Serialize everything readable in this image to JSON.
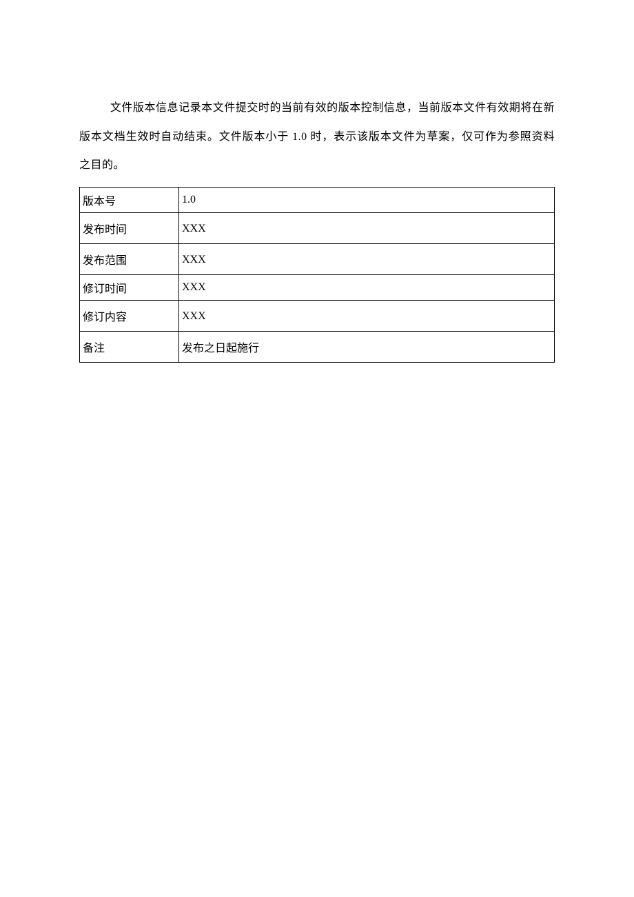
{
  "intro_text": "文件版本信息记录本文件提交时的当前有效的版本控制信息，当前版本文件有效期将在新版本文档生效时自动结束。文件版本小于 1.0 时，表示该版本文件为草案，仅可作为参照资料之目的。",
  "table": {
    "rows": [
      {
        "label": "版本号",
        "value": "1.0"
      },
      {
        "label": "发布时间",
        "value": "XXX"
      },
      {
        "label": "发布范围",
        "value": "XXX"
      },
      {
        "label": "修订时间",
        "value": "XXX"
      },
      {
        "label": "修订内容",
        "value": "XXX"
      },
      {
        "label": "备注",
        "value": "发布之日起施行"
      }
    ]
  }
}
